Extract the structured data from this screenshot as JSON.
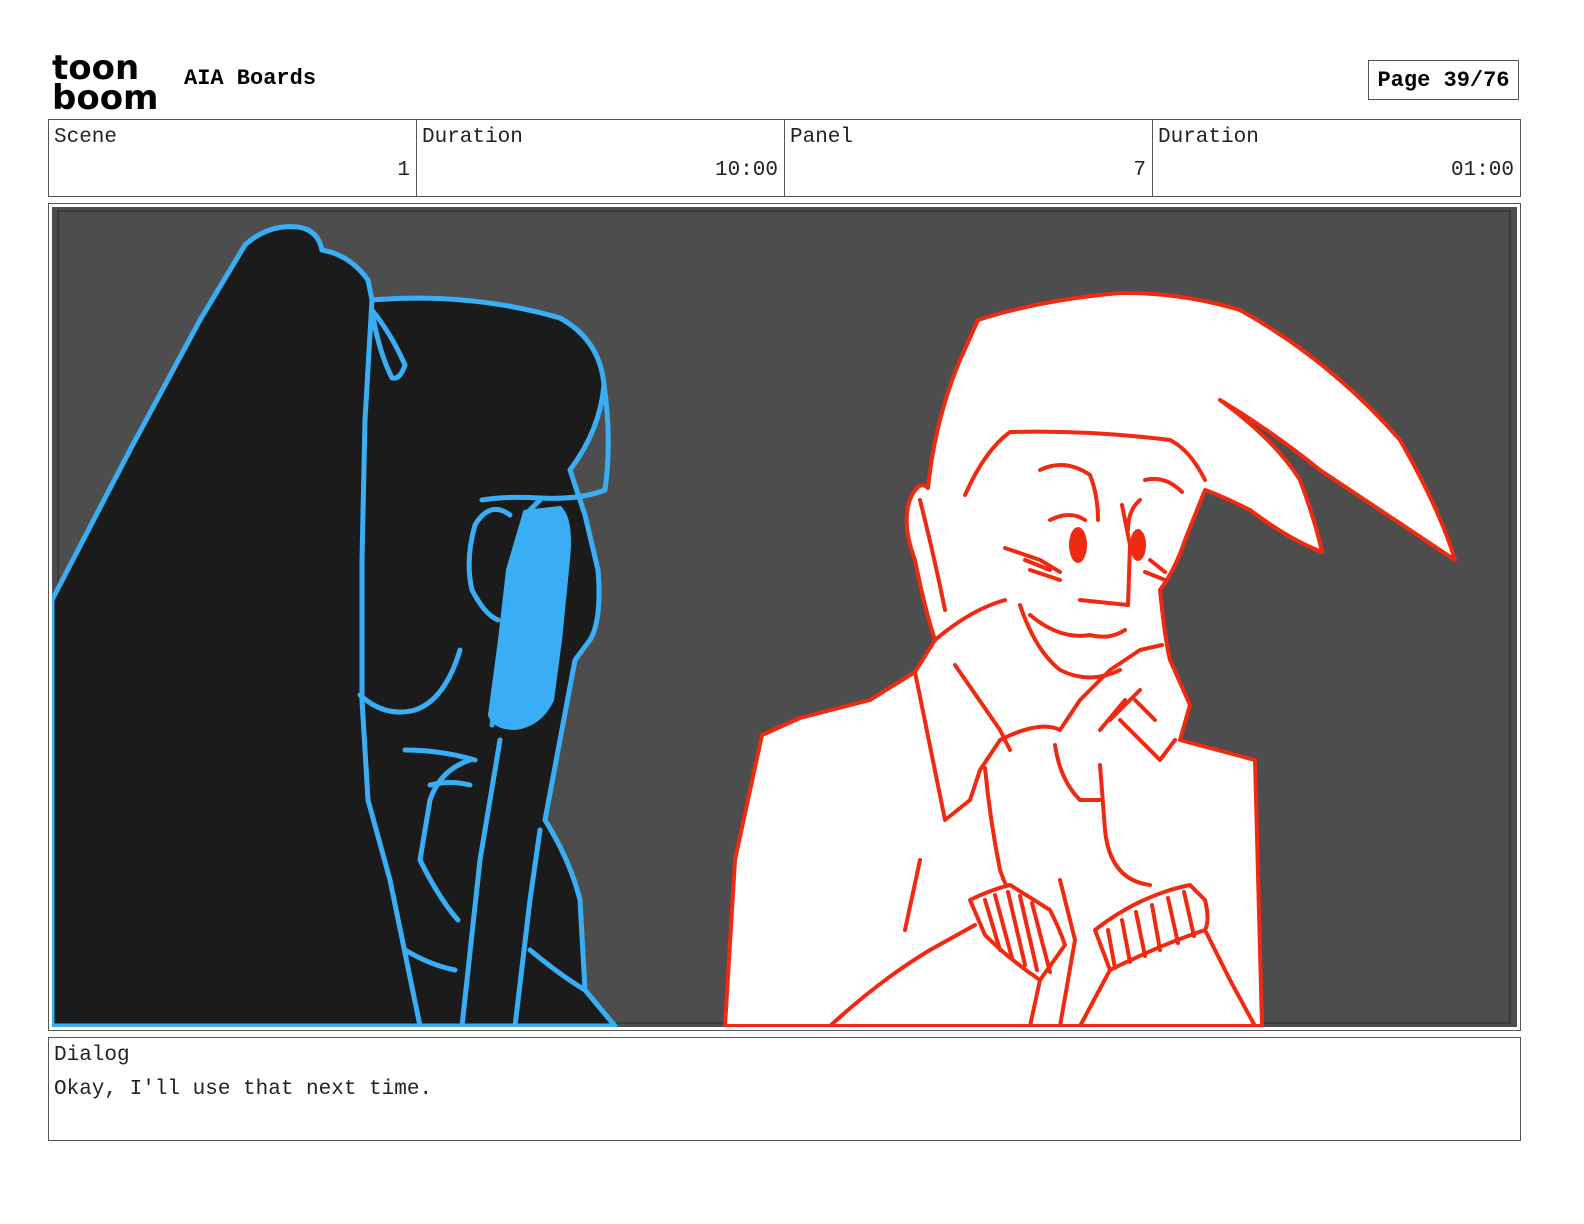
{
  "header": {
    "logo_top": "toon",
    "logo_bottom": "boom",
    "project_title": "AIA Boards",
    "page_label": "Page 39/76"
  },
  "info": {
    "scene_label": "Scene",
    "scene_value": "1",
    "scene_duration_label": "Duration",
    "scene_duration_value": "10:00",
    "panel_label": "Panel",
    "panel_value": "7",
    "panel_duration_label": "Duration",
    "panel_duration_value": "01:00"
  },
  "panel": {
    "background_color": "#4d4d4d",
    "left_figure_line_color": "#3aaef5",
    "left_figure_fill_color": "#1b1b1b",
    "right_figure_line_color": "#f02a10",
    "right_figure_fill_color": "#ffffff"
  },
  "dialog": {
    "label": "Dialog",
    "text": "Okay, I'll use that next time."
  }
}
